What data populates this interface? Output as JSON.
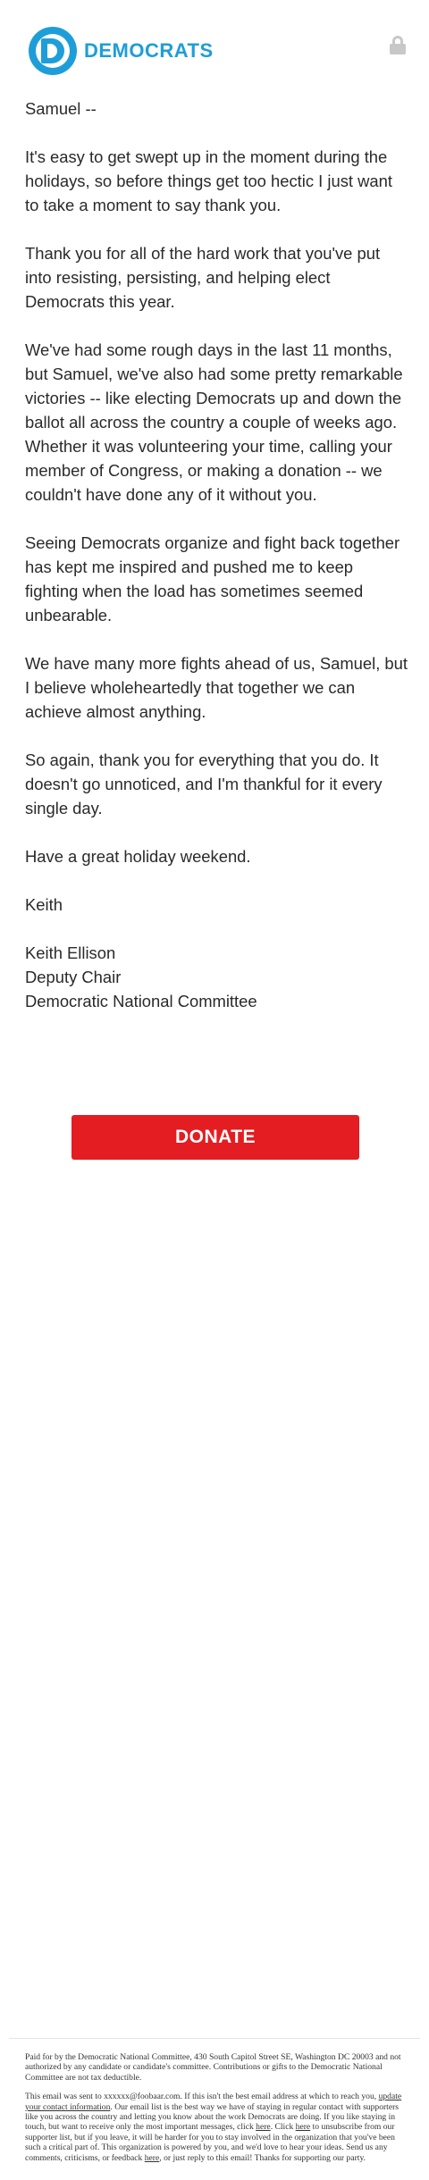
{
  "header": {
    "logo_text": "DEMOCRATS",
    "brand_color": "#1e9ed8",
    "lock_icon": "lock-icon"
  },
  "letter": {
    "greeting": "Samuel --",
    "paragraphs": [
      "It's easy to get swept up in the moment during the holidays, so before things get too hectic I just want to take a moment to say thank you.",
      "Thank you for all of the hard work that you've put into resisting, persisting, and helping elect Democrats this year.",
      "We've had some rough days in the last 11 months, but Samuel, we've also had some pretty remarkable victories -- like electing Democrats up and down the ballot all across the country a couple of weeks ago. Whether it was volunteering your time, calling your member of Congress, or making a donation -- we couldn't have done any of it without you.",
      "Seeing Democrats organize and fight back together has kept me inspired and pushed me to keep fighting when the load has sometimes seemed unbearable.",
      "We have many more fights ahead of us, Samuel, but I believe wholeheartedly that together we can achieve almost anything.",
      "So again, thank you for everything that you do. It doesn't go unnoticed, and I'm thankful for it every single day.",
      "Have a great holiday weekend."
    ],
    "signoff": "Keith",
    "signature": {
      "name": "Keith Ellison",
      "title": "Deputy Chair",
      "org": "Democratic National Committee"
    }
  },
  "donate": {
    "label": "DONATE",
    "color": "#e31d21"
  },
  "footer": {
    "paid_for": "Paid for by the Democratic National Committee, 430 South Capitol Street SE, Washington DC 20003 and not authorized by any candidate or candidate's committee. Contributions or gifts to the Democratic National Committee are not tax deductible.",
    "sent_to_1": "This email was sent to xxxxxx@foobaar.com. If this isn't the best email address at which to reach you, ",
    "update_link": "update your contact information",
    "sent_to_2": ". Our email list is the best way we have of staying in regular contact with supporters like you across the country and letting you know about the work Democrats are doing. If you like staying in touch, but want to receive only the most important messages, click ",
    "here_link_1": "here",
    "sent_to_3": ". Click ",
    "here_link_2": "here",
    "sent_to_4": " to unsubscribe from our supporter list, but if you leave, it will be harder for you to stay involved in the organization that you've been such a critical part of. This organization is powered by you, and we'd love to hear your ideas. Send us any comments, criticisms, or feedback ",
    "here_link_3": "here",
    "sent_to_5": ", or just reply to this email! Thanks for supporting our party."
  }
}
